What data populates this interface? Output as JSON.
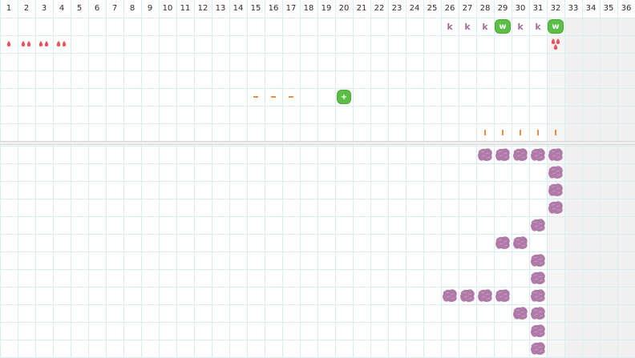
{
  "columns": [
    "1",
    "2",
    "3",
    "4",
    "5",
    "6",
    "7",
    "8",
    "9",
    "10",
    "11",
    "12",
    "13",
    "14",
    "15",
    "16",
    "17",
    "18",
    "19",
    "20",
    "21",
    "22",
    "23",
    "24",
    "25",
    "26",
    "27",
    "28",
    "29",
    "30",
    "31",
    "32",
    "33",
    "34",
    "35",
    "36"
  ],
  "colors": {
    "grid": "#d8ecf2",
    "drop": "#e8555a",
    "k": "#a0709a",
    "green": "#5bbf45",
    "orange": "#f08a3c",
    "blob": "#b07aa8",
    "shade": "#f0f0f0"
  },
  "top_rows": {
    "k_row": [
      {
        "col": 26,
        "label": "k"
      },
      {
        "col": 27,
        "label": "k"
      },
      {
        "col": 28,
        "label": "k"
      },
      {
        "col": 29,
        "label": "w",
        "kind": "green"
      },
      {
        "col": 30,
        "label": "k"
      },
      {
        "col": 31,
        "label": "k"
      },
      {
        "col": 32,
        "label": "w",
        "kind": "green"
      }
    ],
    "drop_row": [
      {
        "col": 1,
        "count": 1
      },
      {
        "col": 2,
        "count": 2
      },
      {
        "col": 3,
        "count": 2
      },
      {
        "col": 4,
        "count": 2
      },
      {
        "col": 32,
        "count": 3
      }
    ],
    "dash_row": [
      {
        "col": 15
      },
      {
        "col": 16
      },
      {
        "col": 17
      }
    ],
    "plus_row": [
      {
        "col": 20,
        "label": "+"
      }
    ],
    "tick_row": [
      {
        "col": 28
      },
      {
        "col": 29
      },
      {
        "col": 30
      },
      {
        "col": 31
      },
      {
        "col": 32
      }
    ]
  },
  "blobs": [
    {
      "row": 1,
      "cols": [
        28,
        29,
        30,
        31,
        32
      ]
    },
    {
      "row": 2,
      "cols": [
        32
      ]
    },
    {
      "row": 3,
      "cols": [
        32
      ]
    },
    {
      "row": 4,
      "cols": [
        32
      ]
    },
    {
      "row": 5,
      "cols": [
        31
      ]
    },
    {
      "row": 6,
      "cols": [
        29,
        30
      ]
    },
    {
      "row": 7,
      "cols": [
        31
      ]
    },
    {
      "row": 8,
      "cols": [
        31
      ]
    },
    {
      "row": 9,
      "cols": [
        26,
        27,
        28,
        29,
        31
      ]
    },
    {
      "row": 10,
      "cols": [
        30,
        31
      ]
    },
    {
      "row": 11,
      "cols": [
        31
      ]
    },
    {
      "row": 12,
      "cols": [
        31
      ]
    }
  ]
}
